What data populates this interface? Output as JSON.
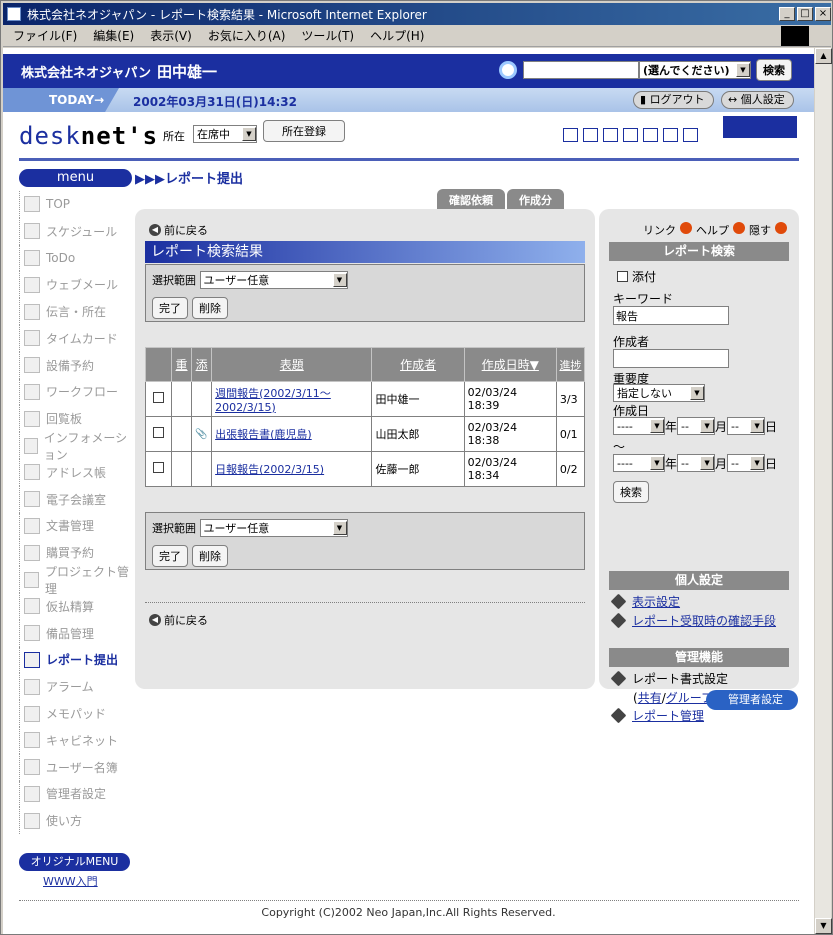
{
  "window": {
    "title": "株式会社ネオジャパン - レポート検索結果 - Microsoft Internet Explorer",
    "min": "_",
    "max": "□",
    "close": "×",
    "menus": [
      "ファイル(F)",
      "編集(E)",
      "表示(V)",
      "お気に入り(A)",
      "ツール(T)",
      "ヘルプ(H)"
    ]
  },
  "header": {
    "company": "株式会社ネオジャパン",
    "user": "田中雄一",
    "search_select": "(選んでください)",
    "search_button": "検索",
    "today": "TODAY→",
    "datetime": "2002年03月31日(日)14:32",
    "logout": "ログアウト",
    "personal": "個人設定"
  },
  "logobar": {
    "logo_a": "desk",
    "logo_b": "net's",
    "location_label": "所在",
    "location_value": "在席中",
    "register_button": "所在登録"
  },
  "menu": {
    "head": "menu",
    "items": [
      "TOP",
      "スケジュール",
      "ToDo",
      "ウェブメール",
      "伝言・所在",
      "タイムカード",
      "設備予約",
      "ワークフロー",
      "回覧板",
      "インフォメーション",
      "アドレス帳",
      "電子会議室",
      "文書管理",
      "購買予約",
      "プロジェクト管理",
      "仮払精算",
      "備品管理",
      "レポート提出",
      "アラーム",
      "メモパッド",
      "キャビネット",
      "ユーザー名簿",
      "管理者設定",
      "使い方"
    ],
    "active": "レポート提出",
    "original": "オリジナルMENU",
    "www": "WWW入門"
  },
  "breadcrumb": "▶▶▶レポート提出",
  "tabs": [
    "確認依頼",
    "作成分"
  ],
  "main": {
    "back": "前に戻る",
    "title": "レポート検索結果",
    "range_label": "選択範囲",
    "range_value": "ユーザー任意",
    "done": "完了",
    "delete": "削除",
    "columns": [
      "重",
      "添",
      "表題",
      "作成者",
      "作成日時▼",
      "進捗"
    ],
    "rows": [
      {
        "title": "週間報告(2002/3/11～2002/3/15)",
        "author": "田中雄一",
        "date": "02/03/24",
        "time": "18:39",
        "progress": "3/3",
        "attach": ""
      },
      {
        "title": "出張報告書(鹿児島)",
        "author": "山田太郎",
        "date": "02/03/24",
        "time": "18:38",
        "progress": "0/1",
        "attach": "📎"
      },
      {
        "title": "日報報告(2002/3/15)",
        "author": "佐藤一郎",
        "date": "02/03/24",
        "time": "18:34",
        "progress": "0/2",
        "attach": ""
      }
    ]
  },
  "right": {
    "link": "リンク",
    "help": "ヘルプ",
    "hide": "隠す",
    "search_head": "レポート検索",
    "attach": "添付",
    "keyword": "キーワード",
    "keyword_value": "報告",
    "author": "作成者",
    "priority": "重要度",
    "priority_value": "指定しない",
    "created": "作成日",
    "tilde": "～",
    "dash": "----",
    "dash2": "--",
    "year": "年",
    "month": "月",
    "day": "日",
    "search_button": "検索",
    "personal_head": "個人設定",
    "display_setting": "表示設定",
    "confirm_method": "レポート受取時の確認手段",
    "admin_head": "管理機能",
    "format_setting": "レポート書式設定",
    "shared": "共有",
    "group": "グループ",
    "report_manage": "レポート管理"
  },
  "admin_button": "管理者設定",
  "copyright": "Copyright (C)2002 Neo Japan,Inc.All Rights Reserved."
}
